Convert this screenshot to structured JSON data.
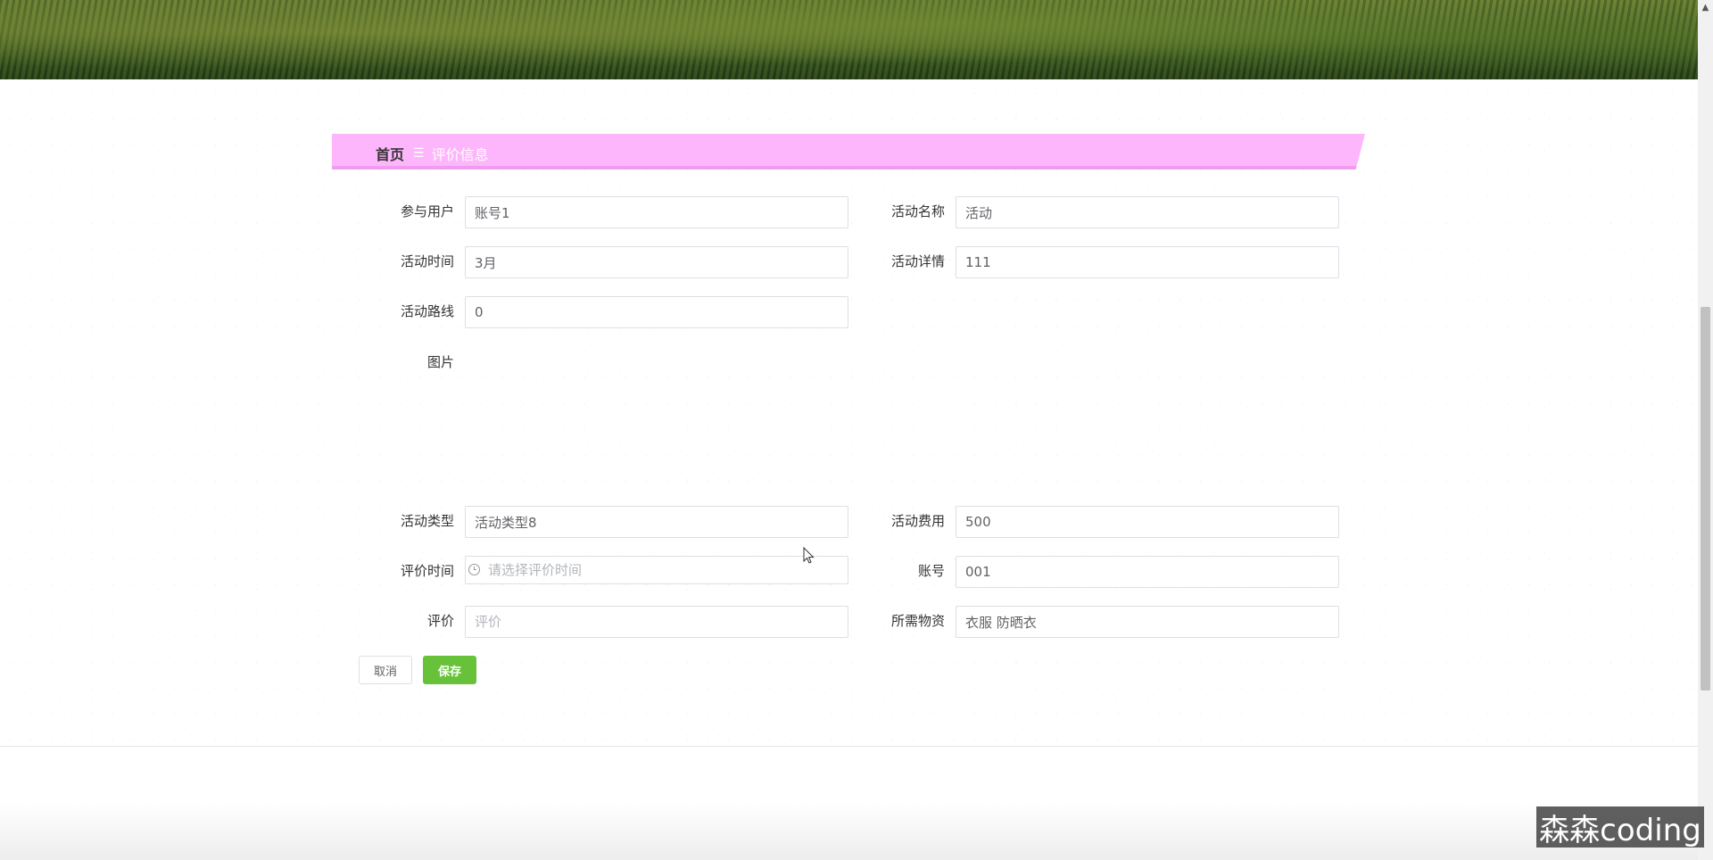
{
  "breadcrumb": {
    "home": "首页",
    "separator": "☰",
    "current": "评价信息"
  },
  "form": {
    "participant_user": {
      "label": "参与用户",
      "value": "账号1"
    },
    "activity_name": {
      "label": "活动名称",
      "value": "活动"
    },
    "activity_time": {
      "label": "活动时间",
      "value": "3月"
    },
    "activity_details": {
      "label": "活动详情",
      "value": "111"
    },
    "activity_route": {
      "label": "活动路线",
      "value": "0"
    },
    "image": {
      "label": "图片"
    },
    "activity_type": {
      "label": "活动类型",
      "value": "活动类型8"
    },
    "activity_fee": {
      "label": "活动费用",
      "value": "500"
    },
    "review_time": {
      "label": "评价时间",
      "placeholder": "请选择评价时间"
    },
    "account": {
      "label": "账号",
      "value": "001"
    },
    "review": {
      "label": "评价",
      "placeholder": "评价"
    },
    "required_supplies": {
      "label": "所需物资",
      "value": "衣服 防晒衣"
    }
  },
  "buttons": {
    "cancel": "取消",
    "save": "保存"
  },
  "watermark": "森森coding",
  "colors": {
    "breadcrumb_bg": "#fdb6fb",
    "save_button": "#67c23a"
  }
}
